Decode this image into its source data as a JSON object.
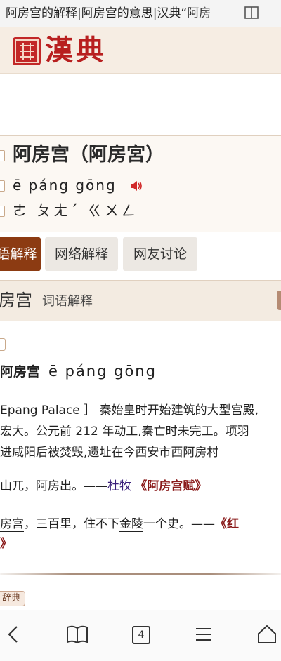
{
  "browser": {
    "title": "阿房宫的解释|阿房宫的意思|汉典“阿房"
  },
  "site": {
    "logo_text": "漢典"
  },
  "entry": {
    "word": "阿房宫",
    "paren_open": "（",
    "traditional": "阿房宮",
    "paren_close": "）",
    "pinyin": "ē páng gōng",
    "zhuyin": "ㄜ ㄆㄤˊ ㄍㄨㄥ"
  },
  "tabs": [
    {
      "label": "语解释"
    },
    {
      "label": "网络解释"
    },
    {
      "label": "网友讨论"
    }
  ],
  "section": {
    "title": "房宫",
    "subtitle": "词语解释"
  },
  "definition": {
    "word": "阿房宫",
    "pinyin": "ē páng gōng",
    "lines": [
      "Epang Palace ］ 秦始皇时开始建筑的大型宫殿,",
      "宏大。公元前 212 年动工,秦亡时未完工。项羽",
      "进咸阳后被焚毁,遗址在今西安市西阿房村"
    ],
    "quote1": {
      "text": "山兀，阿房出。——",
      "author": "杜牧",
      "work": "《阿房宫赋》"
    },
    "quote2": {
      "text_a": "房宫",
      "text_b": "，三百里，住不下",
      "text_c": "金陵",
      "text_d": "一个史。——",
      "work": "《红"
    },
    "quote2_tail": "》",
    "source_badge": "辞典"
  },
  "nav": {
    "tab_count": "4"
  },
  "colors": {
    "accent": "#8c3b12",
    "logo_red": "#b81f1f",
    "header_bg": "#f6ede3"
  }
}
